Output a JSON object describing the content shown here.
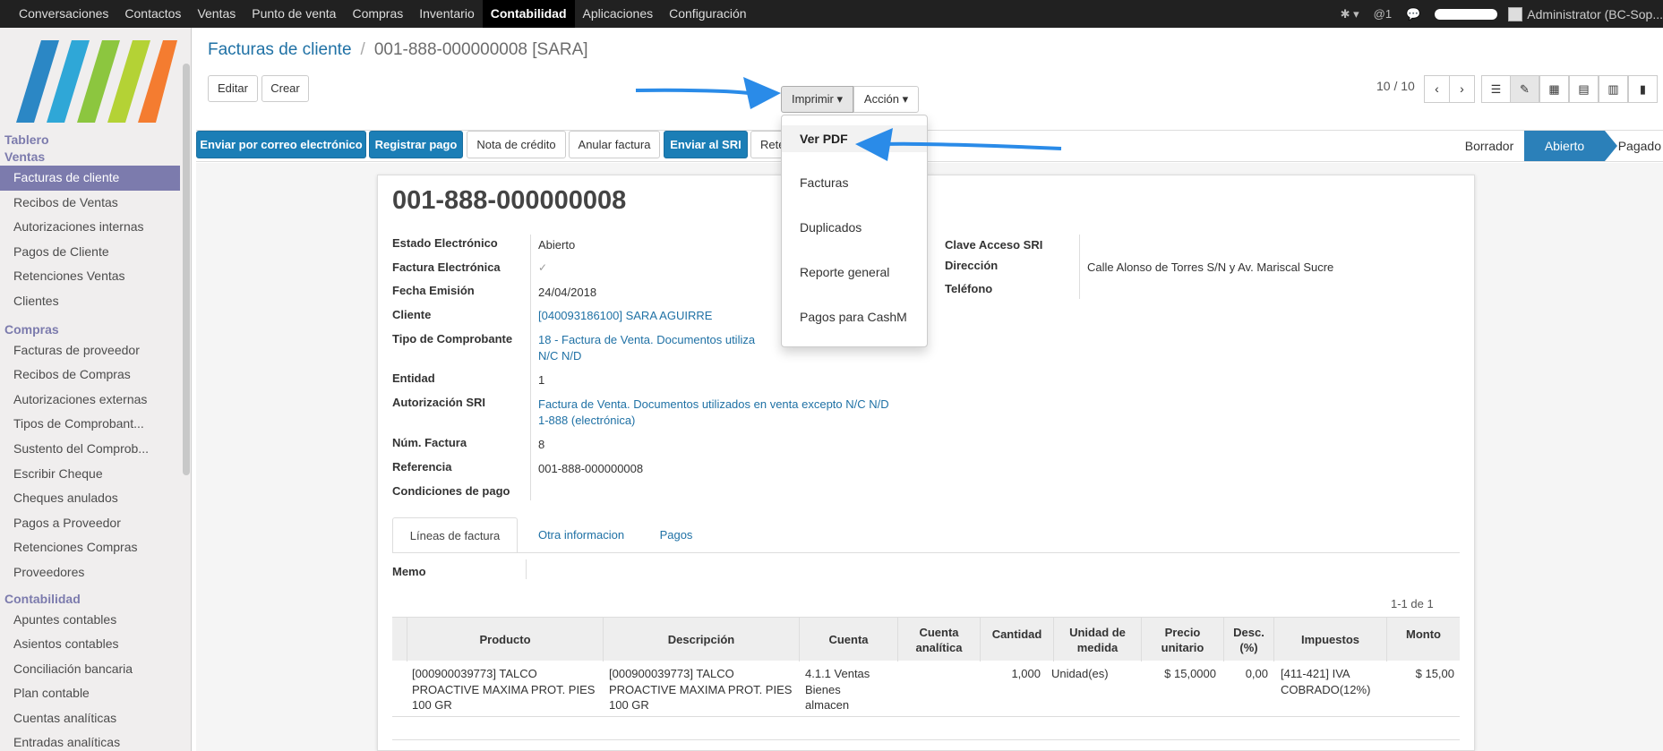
{
  "topbar": {
    "menu": [
      "Conversaciones",
      "Contactos",
      "Ventas",
      "Punto de venta",
      "Compras",
      "Inventario",
      "Contabilidad",
      "Aplicaciones",
      "Configuración"
    ],
    "active": "Contabilidad",
    "notifications": "@1",
    "user": "Administrator (BC-Sop..."
  },
  "sidebar": {
    "sections": [
      {
        "title": "Tablero",
        "items": []
      },
      {
        "title": "Ventas",
        "items": [
          "Facturas de cliente",
          "Recibos de Ventas",
          "Autorizaciones internas",
          "Pagos de Cliente",
          "Retenciones Ventas",
          "Clientes"
        ]
      },
      {
        "title": "Compras",
        "items": [
          "Facturas de proveedor",
          "Recibos de Compras",
          "Autorizaciones externas",
          "Tipos de Comprobant...",
          "Sustento del Comprob...",
          "Escribir Cheque",
          "Cheques anulados",
          "Pagos a Proveedor",
          "Retenciones Compras",
          "Proveedores"
        ]
      },
      {
        "title": "Contabilidad",
        "items": [
          "Apuntes contables",
          "Asientos contables",
          "Conciliación bancaria",
          "Plan contable",
          "Cuentas analíticas",
          "Entradas analíticas"
        ]
      }
    ],
    "selected": "Facturas de cliente"
  },
  "breadcrumb": {
    "parent": "Facturas de cliente",
    "separator": "/",
    "current": "001-888-000000008 [SARA]"
  },
  "toolbar": {
    "edit": "Editar",
    "create": "Crear",
    "print": "Imprimir",
    "action": "Acción"
  },
  "pager": {
    "value": "10 / 10",
    "prev": "‹",
    "next": "›"
  },
  "view_icons": [
    "list-view-icon",
    "form-view-icon",
    "kanban-view-icon",
    "calendar-view-icon",
    "pivot-view-icon",
    "graph-view-icon"
  ],
  "header_buttons": {
    "email": "Enviar por correo electrónico",
    "register_payment": "Registrar pago",
    "credit_note": "Nota de crédito",
    "cancel": "Anular factura",
    "send_sri": "Enviar al SRI",
    "retention": "Rete"
  },
  "statusbar": [
    "Borrador",
    "Abierto",
    "Pagado"
  ],
  "status_current": "Abierto",
  "print_menu": [
    "Ver PDF",
    "Facturas",
    "Duplicados",
    "Reporte general",
    "Pagos para CashM"
  ],
  "invoice": {
    "number": "001-888-000000008",
    "fields": [
      {
        "label": "Estado Electrónico",
        "value": "Abierto"
      },
      {
        "label": "Factura Electrónica",
        "value": "✓"
      },
      {
        "label": "Fecha Emisión",
        "value": "24/04/2018"
      },
      {
        "label": "Cliente",
        "value": "[040093186100] SARA AGUIRRE"
      },
      {
        "label": "Tipo de Comprobante",
        "value": "18 - Factura de Venta. Documentos utiliza",
        "value2": "N/C N/D"
      },
      {
        "label": "Entidad",
        "value": "1"
      },
      {
        "label": "Autorización SRI",
        "value": "Factura de Venta. Documentos utilizados en venta excepto N/C N/D",
        "value2": "1-888 (electrónica)"
      },
      {
        "label": "Núm. Factura",
        "value": "8"
      },
      {
        "label": "Referencia",
        "value": "001-888-000000008"
      },
      {
        "label": "Condiciones de pago",
        "value": ""
      }
    ],
    "right_fields": [
      {
        "label": "Clave Acceso SRI",
        "value": ""
      },
      {
        "label": "Dirección",
        "value": "Calle Alonso de Torres S/N y Av. Mariscal Sucre"
      },
      {
        "label": "Teléfono",
        "value": ""
      }
    ]
  },
  "tabs": [
    "Líneas de factura",
    "Otra informacion",
    "Pagos"
  ],
  "memo_label": "Memo",
  "lines": {
    "counter": "1-1 de 1",
    "columns": [
      "Producto",
      "Descripción",
      "Cuenta",
      "Cuenta analítica",
      "Cantidad",
      "Unidad de medida",
      "Precio unitario",
      "Desc. (%)",
      "Impuestos",
      "Monto"
    ],
    "rows": [
      {
        "producto": [
          "[000900039773] TALCO",
          "PROACTIVE MAXIMA PROT. PIES",
          "100 GR"
        ],
        "descripcion": [
          "[000900039773] TALCO",
          "PROACTIVE MAXIMA PROT. PIES",
          "100 GR"
        ],
        "cuenta": [
          "4.1.1 Ventas",
          "Bienes",
          "almacen"
        ],
        "analitica": "",
        "cantidad": "1,000",
        "unidad": "Unidad(es)",
        "precio": "$ 15,0000",
        "desc": "0,00",
        "impuestos": [
          "[411-421] IVA",
          "COBRADO(12%)"
        ],
        "monto": "$ 15,00"
      }
    ]
  },
  "colors": {
    "accent": "#7c7bad",
    "primary": "#1b7eb6",
    "link": "#1f71a5",
    "arrow": "#2a8be8"
  }
}
